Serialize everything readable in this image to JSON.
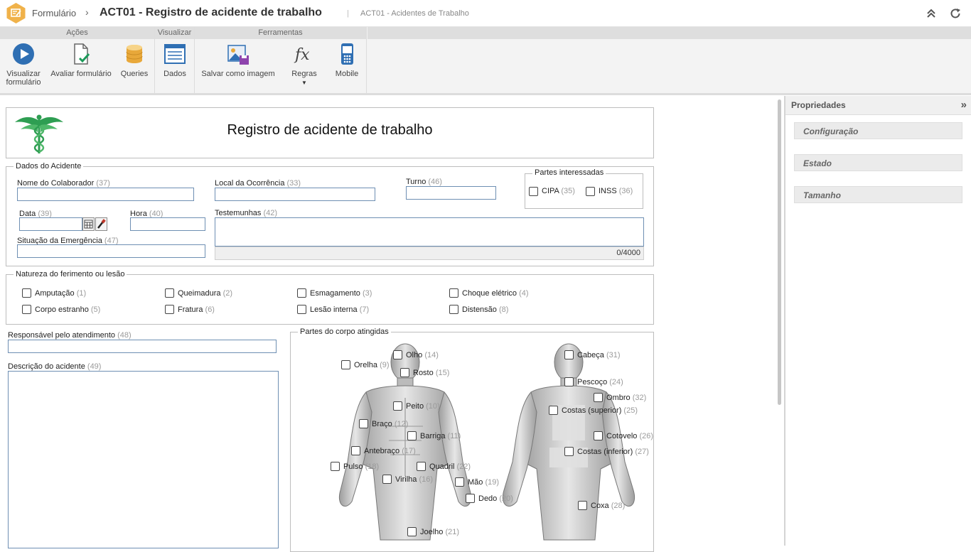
{
  "header": {
    "app": "Formulário",
    "separator": "›",
    "title": "ACT01 - Registro de acidente de trabalho",
    "bar": "|",
    "subtitle": "ACT01 - Acidentes de Trabalho"
  },
  "ribbon": {
    "groups": [
      "Ações",
      "Visualizar",
      "Ferramentas"
    ],
    "buttons": {
      "visualizar_formulario": "Visualizar formulário",
      "avaliar_formulario": "Avaliar formulário",
      "queries": "Queries",
      "dados": "Dados",
      "salvar_como_imagem": "Salvar como imagem",
      "regras": "Regras",
      "mobile": "Mobile"
    }
  },
  "properties": {
    "title": "Propriedades",
    "collapse": "»",
    "sections": [
      "Configuração",
      "Estado",
      "Tamanho"
    ]
  },
  "form": {
    "title": "Registro de acidente de trabalho",
    "dados": {
      "legend": "Dados do Acidente",
      "nome": "Nome do Colaborador",
      "nome_n": "(37)",
      "local": "Local da Ocorrência",
      "local_n": "(33)",
      "turno": "Turno",
      "turno_n": "(46)",
      "data": "Data",
      "data_n": "(39)",
      "hora": "Hora",
      "hora_n": "(40)",
      "testemunhas": "Testemunhas",
      "testemunhas_n": "(42)",
      "counter": "0/4000",
      "situacao": "Situação da Emergência",
      "situacao_n": "(47)"
    },
    "partes": {
      "legend": "Partes interessadas",
      "cipa": "CIPA",
      "cipa_n": "(35)",
      "inss": "INSS",
      "inss_n": "(36)"
    },
    "natureza": {
      "legend": "Natureza do ferimento ou lesão",
      "items": [
        {
          "label": "Amputação",
          "n": "(1)"
        },
        {
          "label": "Queimadura",
          "n": "(2)"
        },
        {
          "label": "Esmagamento",
          "n": "(3)"
        },
        {
          "label": "Choque elétrico",
          "n": "(4)"
        },
        {
          "label": "Corpo estranho",
          "n": "(5)"
        },
        {
          "label": "Fratura",
          "n": "(6)"
        },
        {
          "label": "Lesão interna",
          "n": "(7)"
        },
        {
          "label": "Distensão",
          "n": "(8)"
        }
      ]
    },
    "responsavel": "Responsável pelo atendimento",
    "responsavel_n": "(48)",
    "descricao": "Descrição do acidente",
    "descricao_n": "(49)",
    "corpo": {
      "legend": "Partes do corpo atingidas",
      "items": [
        {
          "label": "Olho",
          "n": "(14)"
        },
        {
          "label": "Orelha",
          "n": "(9)"
        },
        {
          "label": "Rosto",
          "n": "(15)"
        },
        {
          "label": "Peito",
          "n": "(10)"
        },
        {
          "label": "Braço",
          "n": "(12)"
        },
        {
          "label": "Barriga",
          "n": "(11)"
        },
        {
          "label": "Antebraço",
          "n": "(17)"
        },
        {
          "label": "Pulso",
          "n": "(18)"
        },
        {
          "label": "Quadril",
          "n": "(22)"
        },
        {
          "label": "Virilha",
          "n": "(16)"
        },
        {
          "label": "Mão",
          "n": "(19)"
        },
        {
          "label": "Dedo",
          "n": "(20)"
        },
        {
          "label": "Joelho",
          "n": "(21)"
        },
        {
          "label": "Cabeça",
          "n": "(31)"
        },
        {
          "label": "Pescoço",
          "n": "(24)"
        },
        {
          "label": "Ombro",
          "n": "(32)"
        },
        {
          "label": "Costas (superior)",
          "n": "(25)"
        },
        {
          "label": "Cotovelo",
          "n": "(26)"
        },
        {
          "label": "Costas (inferior)",
          "n": "(27)"
        },
        {
          "label": "Coxa",
          "n": "(28)"
        }
      ]
    }
  },
  "colors": {
    "accent": "#e8a83a",
    "blue": "#2f6fb3",
    "field_border": "#6e8fb3"
  }
}
